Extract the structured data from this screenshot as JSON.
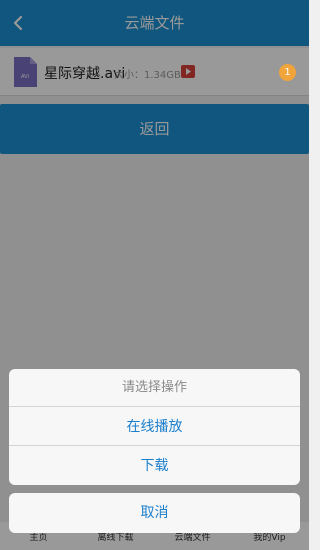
{
  "header": {
    "title": "云端文件",
    "back_icon": "chevron-left-icon"
  },
  "file": {
    "icon": "avi-file-icon",
    "icon_text": "AVI",
    "name": "星际穿越.avi",
    "size": "大小：1.34GB",
    "play_icon": "play-icon",
    "badge": "1"
  },
  "back_button": {
    "label": "返回"
  },
  "tabs": [
    "主页",
    "离线下载",
    "云端文件",
    "我的Vip"
  ],
  "action_sheet": {
    "title": "请选择操作",
    "options": [
      "在线播放",
      "下载"
    ],
    "cancel": "取消"
  },
  "colors": {
    "accent": "#1b90d2",
    "action_text": "#1b7fcc",
    "badge": "#f0a43a",
    "play": "#d9403a"
  }
}
